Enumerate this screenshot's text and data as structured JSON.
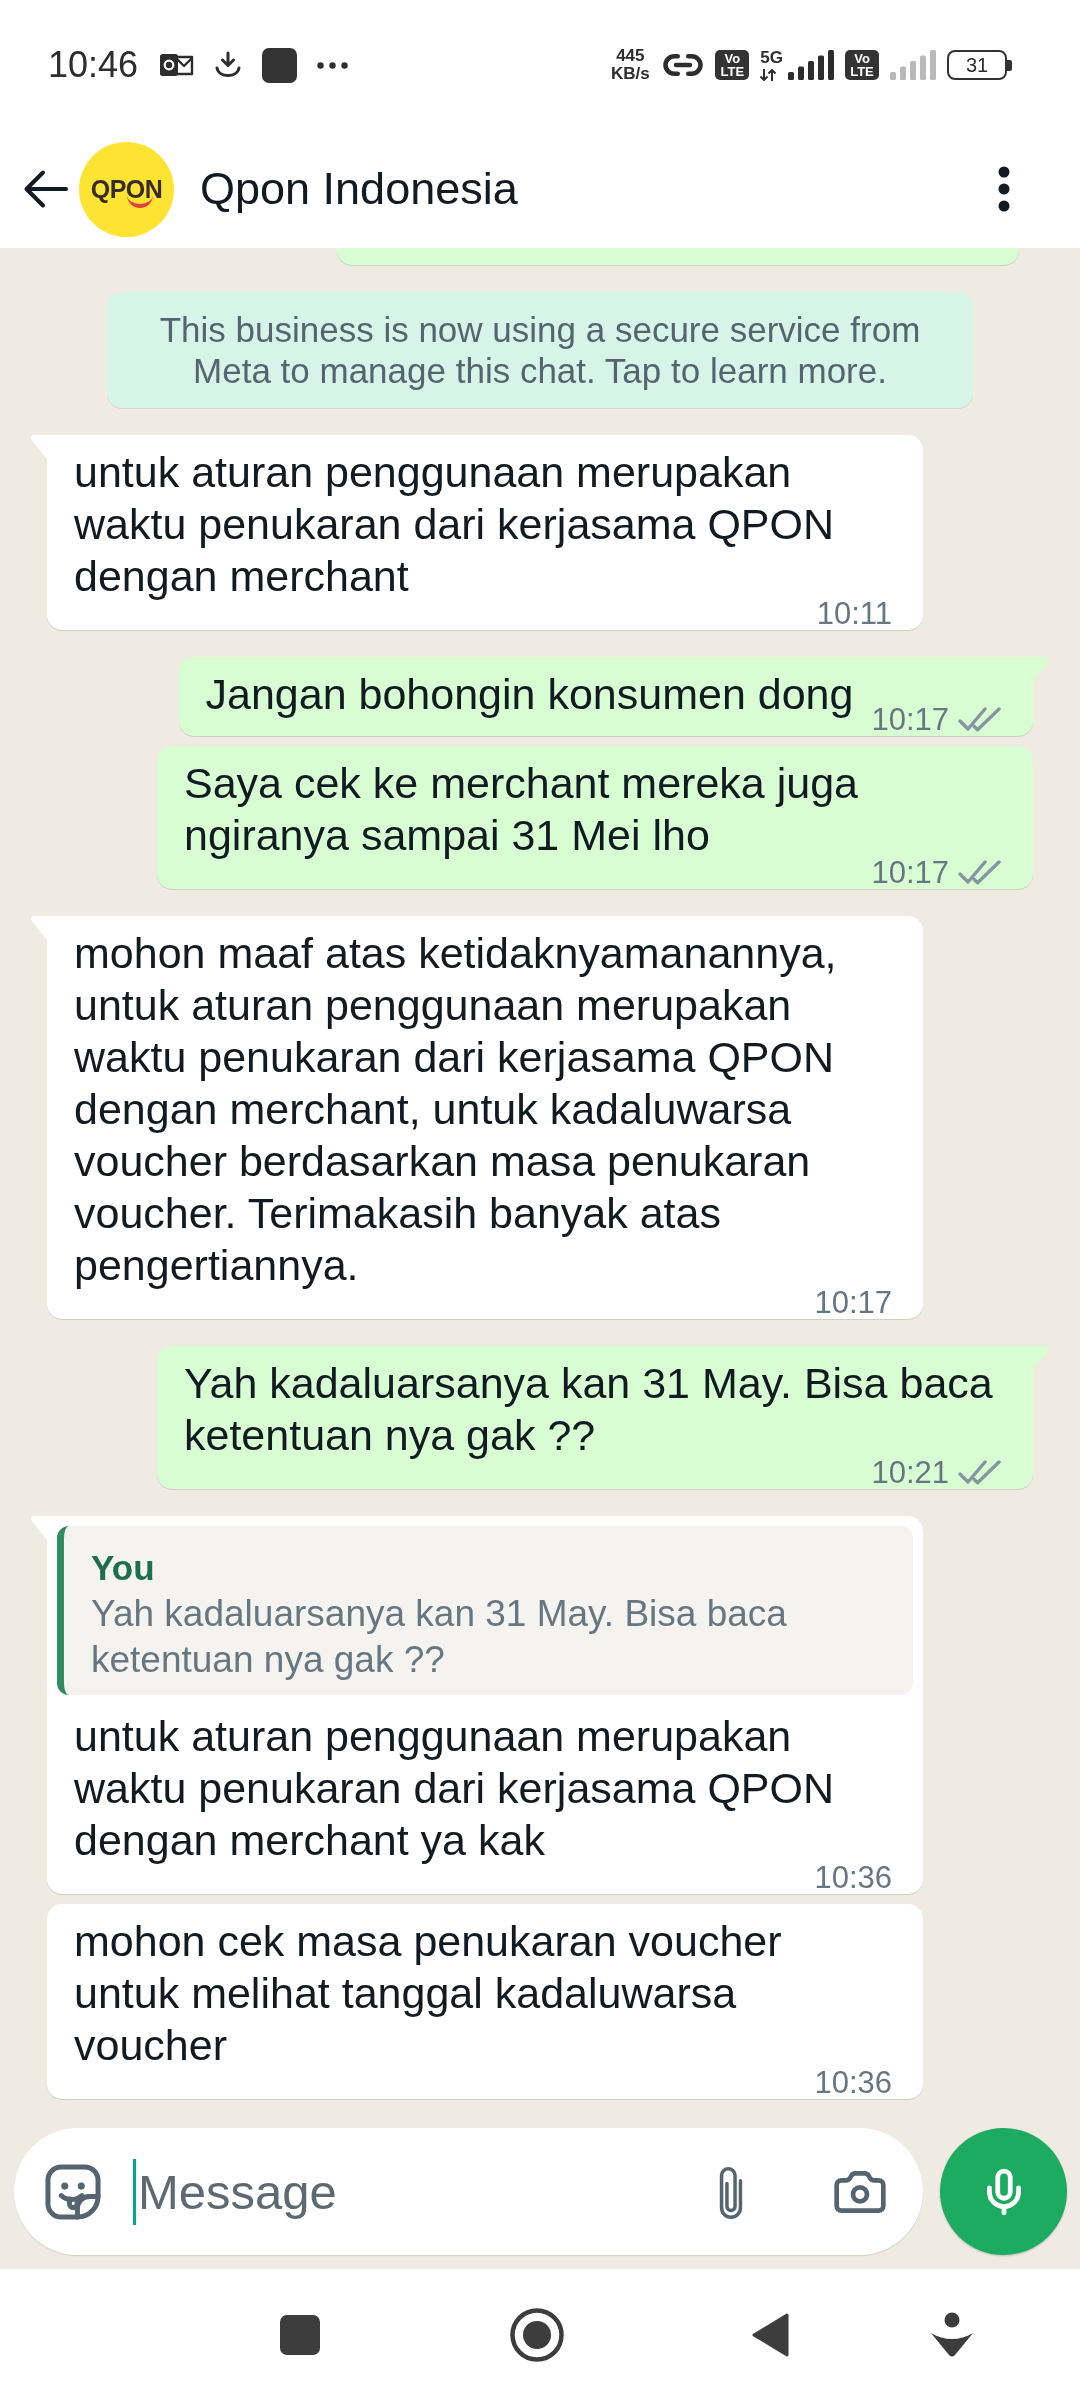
{
  "status_bar": {
    "time": "10:46",
    "net_speed": "445 KB/s",
    "sims": [
      {
        "badge": "Vo LTE",
        "network": "5G"
      },
      {
        "badge": "Vo LTE"
      }
    ],
    "battery": "31"
  },
  "header": {
    "avatar_logo": "QPON",
    "title": "Qpon Indonesia"
  },
  "messages": [
    {
      "kind": "clipped",
      "outgoing": true
    },
    {
      "kind": "notice",
      "text": "This business is now using a secure service from Meta to manage this chat. Tap to learn more."
    },
    {
      "kind": "text",
      "outgoing": false,
      "text": "untuk aturan penggunaan merupakan waktu penukaran dari kerjasama QPON dengan merchant",
      "time": "10:11"
    },
    {
      "kind": "text",
      "outgoing": true,
      "text": "Jangan bohongin konsumen dong",
      "time": "10:17",
      "delivered": true,
      "read": false
    },
    {
      "kind": "text",
      "outgoing": true,
      "text": "Saya cek ke merchant mereka juga ngiranya sampai 31 Mei lho",
      "time": "10:17",
      "delivered": true,
      "read": false
    },
    {
      "kind": "text",
      "outgoing": false,
      "text": "mohon maaf atas ketidaknyamanannya, untuk aturan penggunaan merupakan waktu penukaran dari kerjasama QPON dengan merchant, untuk kadaluwarsa voucher berdasarkan masa penukaran voucher. Terimakasih banyak atas pengertiannya.",
      "time": "10:17"
    },
    {
      "kind": "text",
      "outgoing": true,
      "text": "Yah kadaluarsanya kan 31 May. Bisa baca ketentuan nya gak ??",
      "time": "10:21",
      "delivered": true,
      "read": false
    },
    {
      "kind": "reply",
      "outgoing": false,
      "quote": {
        "author": "You",
        "text": "Yah kadaluarsanya kan 31 May. Bisa baca ketentuan nya gak ??"
      },
      "text": "untuk aturan penggunaan merupakan waktu penukaran dari kerjasama QPON dengan merchant ya kak",
      "time": "10:36"
    },
    {
      "kind": "text",
      "outgoing": false,
      "text": "mohon cek masa penukaran voucher untuk melihat tanggal kadaluwarsa voucher",
      "time": "10:36"
    }
  ],
  "composer": {
    "placeholder": "Message",
    "focused": true
  }
}
